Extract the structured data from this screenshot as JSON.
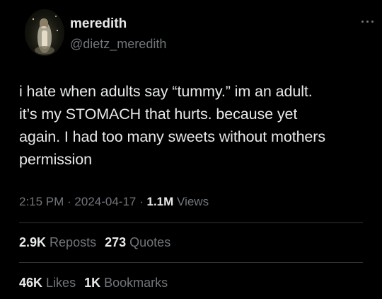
{
  "author": {
    "name": "meredith",
    "handle": "@dietz_meredith",
    "avatar_icon": "profile-photo-icon"
  },
  "tweet": {
    "lines": [
      "i hate when adults say “tummy.” im an adult.",
      "it’s my STOMACH that hurts. because yet",
      "again. I had too many sweets without mothers",
      "permission"
    ]
  },
  "meta": {
    "time": "2:15 PM",
    "separator": " · ",
    "date": "2024-04-17",
    "views_count": "1.1M",
    "views_label": "Views"
  },
  "engagement": {
    "reposts_count": "2.9K",
    "reposts_label": "Reposts",
    "quotes_count": "273",
    "quotes_label": "Quotes",
    "likes_count": "46K",
    "likes_label": "Likes",
    "bookmarks_count": "1K",
    "bookmarks_label": "Bookmarks"
  },
  "colors": {
    "background": "#000000",
    "text": "#e7e9ea",
    "secondary": "#71767b",
    "divider": "#2f3336"
  }
}
